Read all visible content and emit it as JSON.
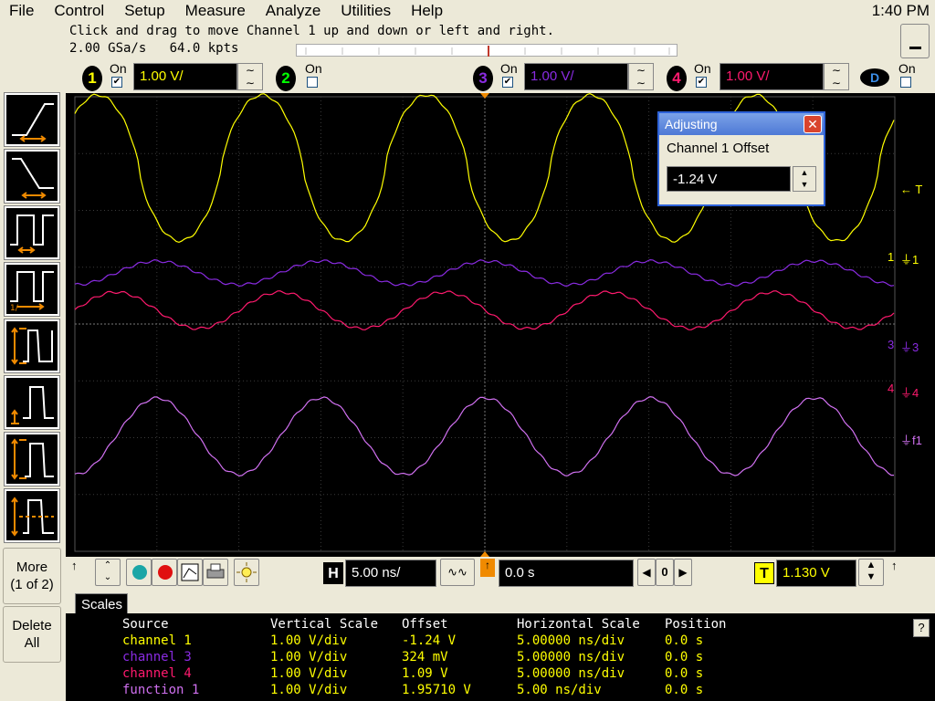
{
  "menu": {
    "items": [
      "File",
      "Control",
      "Setup",
      "Measure",
      "Analyze",
      "Utilities",
      "Help"
    ],
    "clock": "1:40 PM"
  },
  "status": {
    "message": "Click and drag to move Channel 1 up and down or left and right.",
    "sample_rate": "2.00 GSa/s",
    "memory_depth": "64.0 kpts"
  },
  "channels": [
    {
      "num": "1",
      "on_label": "On",
      "checked": true,
      "scale": "1.00 V/",
      "color": "#ffff00"
    },
    {
      "num": "2",
      "on_label": "On",
      "checked": false,
      "color": "#00ff00"
    },
    {
      "num": "3",
      "on_label": "On",
      "checked": true,
      "scale": "1.00 V/",
      "color": "#8a2be2"
    },
    {
      "num": "4",
      "on_label": "On",
      "checked": true,
      "scale": "1.00 V/",
      "color": "#ff1a6e"
    }
  ],
  "digital": {
    "label": "D",
    "on_label": "On",
    "checked": false
  },
  "left_panel": {
    "more_label": "More",
    "more_sub": "(1 of 2)",
    "delete_label": "Delete",
    "delete_sub": "All"
  },
  "dialog": {
    "title": "Adjusting",
    "label": "Channel 1 Offset",
    "value": "-1.24 V"
  },
  "markers": {
    "trigger": "T",
    "ch1": "1",
    "ch1_ground": "1",
    "ch3": "3",
    "ch3_ground": "3",
    "ch4": "4",
    "ch4_ground": "4",
    "f1_ground": "f1"
  },
  "horizontal": {
    "h_label": "H",
    "scale": "5.00 ns/",
    "position": "0.0 s",
    "zero_label": "0"
  },
  "trigger": {
    "t_label": "T",
    "level": "1.130 V"
  },
  "tabs": {
    "scales": "Scales"
  },
  "table": {
    "headers": [
      "Source",
      "Vertical Scale",
      "Offset",
      "Horizontal Scale",
      "Position"
    ],
    "rows": [
      {
        "source": "channel 1",
        "vscale": "1.00 V/div",
        "offset": "-1.24 V",
        "hscale": "5.00000 ns/div",
        "position": "0.0 s",
        "color": "#ffff00"
      },
      {
        "source": "channel 3",
        "vscale": "1.00 V/div",
        "offset": "324 mV",
        "hscale": "5.00000 ns/div",
        "position": "0.0 s",
        "color": "#8a2be2"
      },
      {
        "source": "channel 4",
        "vscale": "1.00 V/div",
        "offset": "1.09 V",
        "hscale": "5.00000 ns/div",
        "position": "0.0 s",
        "color": "#ff1a6e"
      },
      {
        "source": "function 1",
        "vscale": "1.00 V/div",
        "offset": "1.95710 V",
        "hscale": "5.00 ns/div",
        "position": "0.0 s",
        "color": "#d070f0"
      }
    ]
  },
  "help_label": "?"
}
